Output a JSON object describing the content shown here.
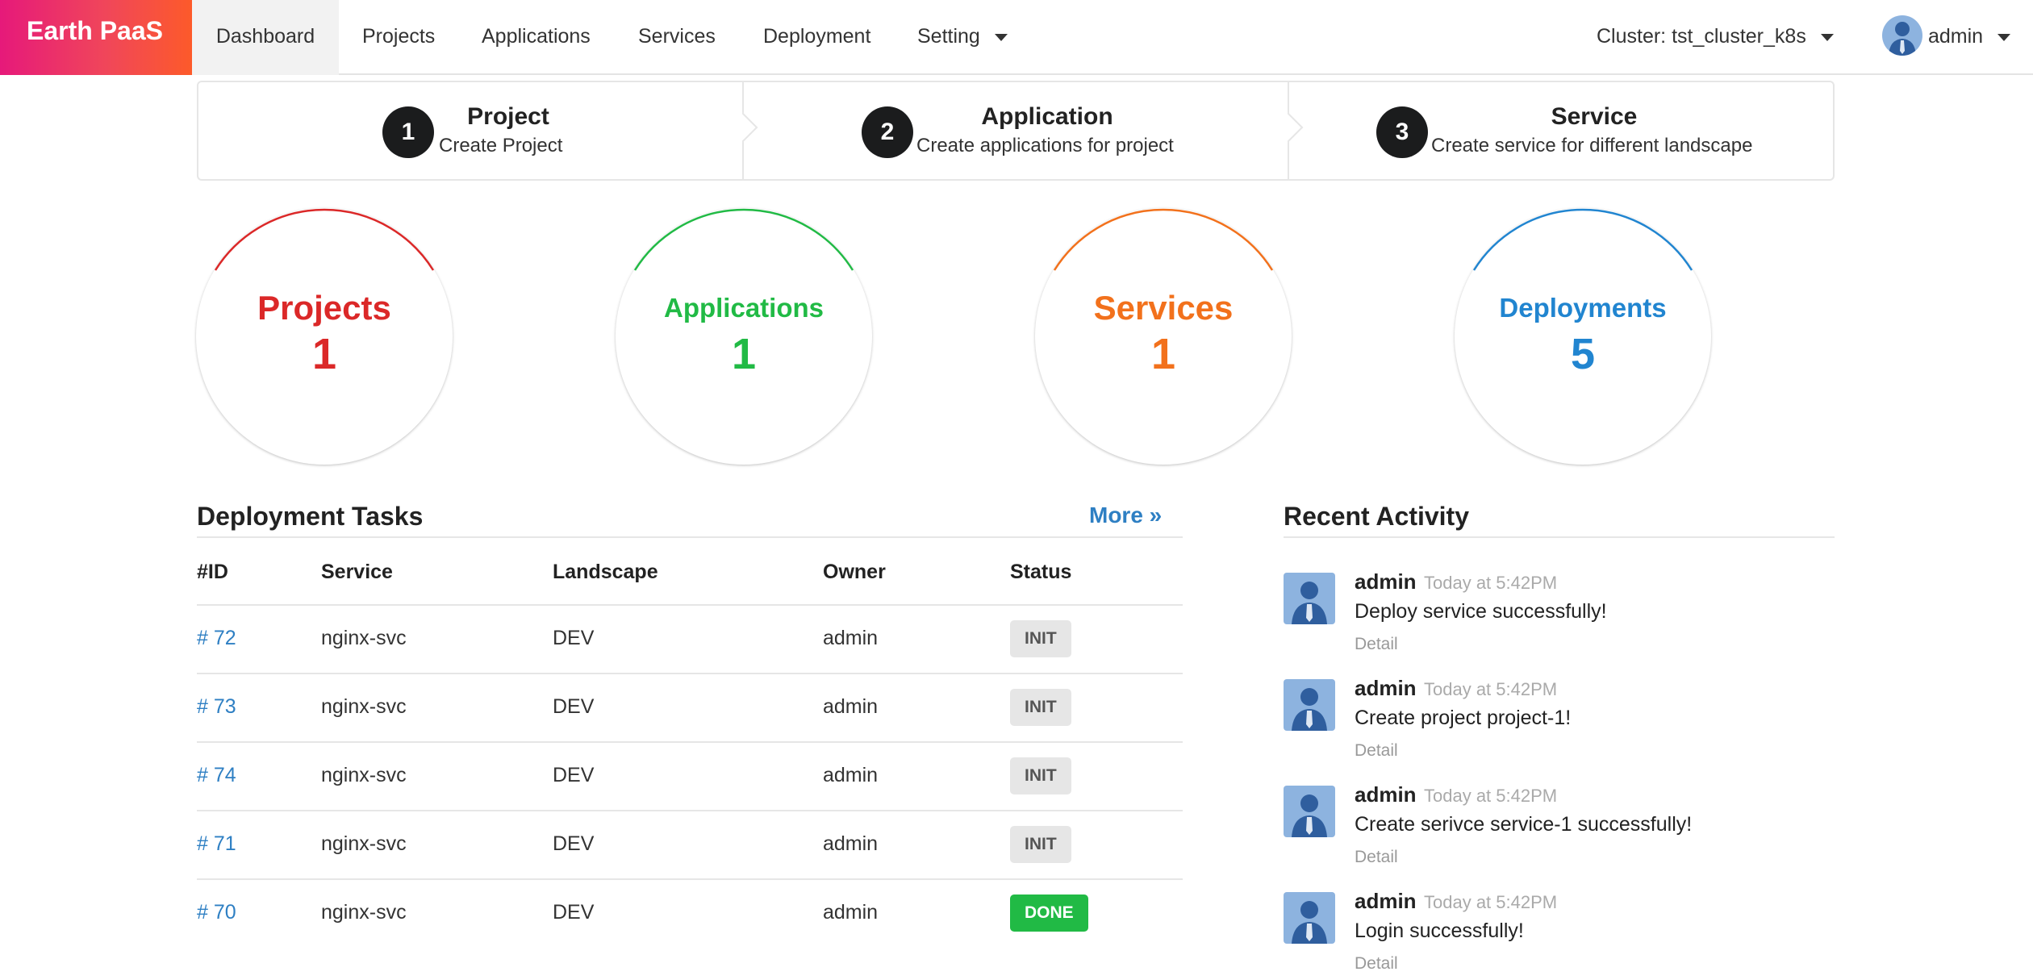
{
  "brand": "Earth PaaS",
  "nav": {
    "items": [
      "Dashboard",
      "Projects",
      "Applications",
      "Services",
      "Deployment",
      "Setting"
    ],
    "active": "Dashboard",
    "cluster": "Cluster: tst_cluster_k8s",
    "user": "admin"
  },
  "steps": [
    {
      "num": "1",
      "title": "Project",
      "desc": "Create Project"
    },
    {
      "num": "2",
      "title": "Application",
      "desc": "Create applications for project"
    },
    {
      "num": "3",
      "title": "Service",
      "desc": "Create service for different landscape"
    }
  ],
  "stats": [
    {
      "label": "Projects",
      "value": "1",
      "color": "#db2828"
    },
    {
      "label": "Applications",
      "value": "1",
      "color": "#21ba45"
    },
    {
      "label": "Services",
      "value": "1",
      "color": "#f2711c"
    },
    {
      "label": "Deployments",
      "value": "5",
      "color": "#2185d0"
    }
  ],
  "tasks": {
    "title": "Deployment Tasks",
    "more": "More »",
    "headers": [
      "#ID",
      "Service",
      "Landscape",
      "Owner",
      "Status"
    ],
    "rows": [
      {
        "id": "# 72",
        "service": "nginx-svc",
        "landscape": "DEV",
        "owner": "admin",
        "status": "INIT"
      },
      {
        "id": "# 73",
        "service": "nginx-svc",
        "landscape": "DEV",
        "owner": "admin",
        "status": "INIT"
      },
      {
        "id": "# 74",
        "service": "nginx-svc",
        "landscape": "DEV",
        "owner": "admin",
        "status": "INIT"
      },
      {
        "id": "# 71",
        "service": "nginx-svc",
        "landscape": "DEV",
        "owner": "admin",
        "status": "INIT"
      },
      {
        "id": "# 70",
        "service": "nginx-svc",
        "landscape": "DEV",
        "owner": "admin",
        "status": "DONE"
      }
    ]
  },
  "activity": {
    "title": "Recent Activity",
    "items": [
      {
        "user": "admin",
        "time": "Today at 5:42PM",
        "text": "Deploy service successfully!",
        "detail": "Detail"
      },
      {
        "user": "admin",
        "time": "Today at 5:42PM",
        "text": "Create project project-1!",
        "detail": "Detail"
      },
      {
        "user": "admin",
        "time": "Today at 5:42PM",
        "text": "Create serivce service-1 successfully!",
        "detail": "Detail"
      },
      {
        "user": "admin",
        "time": "Today at 5:42PM",
        "text": "Login successfully!",
        "detail": "Detail"
      }
    ]
  },
  "icons": {
    "caret": "caret-down-icon",
    "avatar": "user-avatar-icon"
  }
}
